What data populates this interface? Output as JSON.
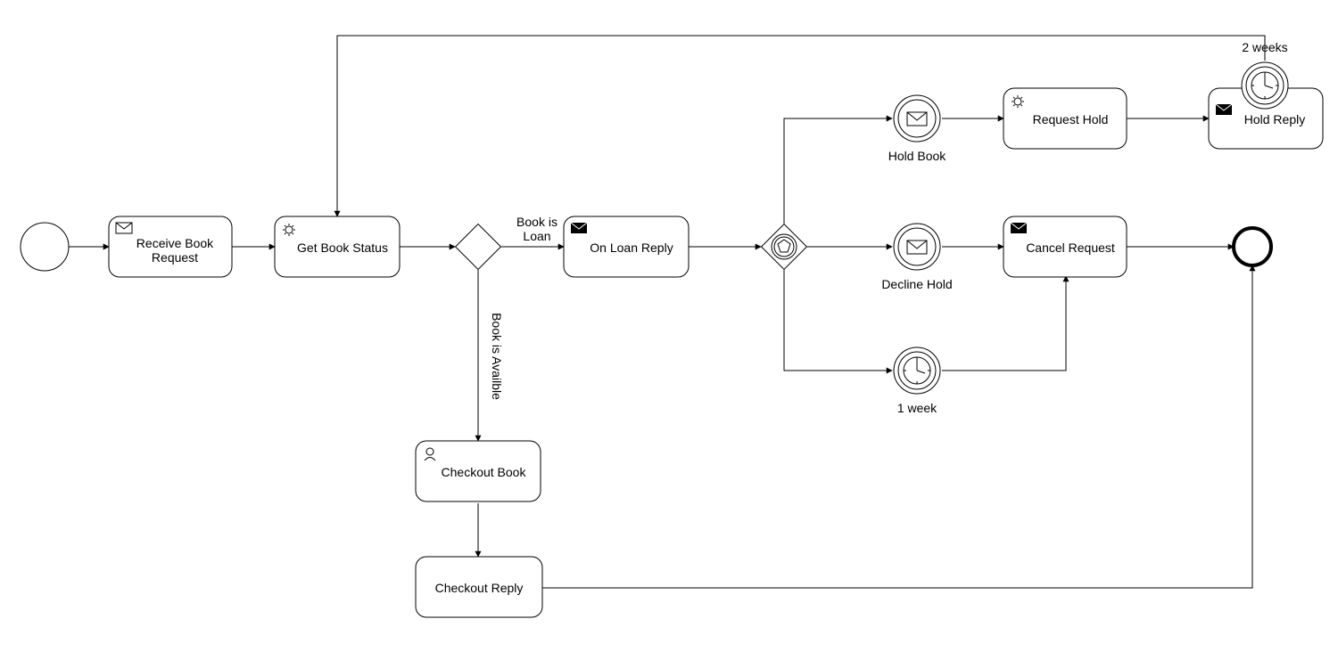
{
  "tasks": {
    "receive": "Receive Book Request",
    "getstatus": "Get Book Status",
    "onloan": "On Loan Reply",
    "requesthold": "Request Hold",
    "holdreply": "Hold Reply",
    "cancel": "Cancel Request",
    "checkoutbook": "Checkout Book",
    "checkoutreply": "Checkout Reply"
  },
  "events": {
    "holdbook": "Hold Book",
    "declinehold": "Decline Hold",
    "oneweek": "1 week",
    "twoweeks": "2 weeks"
  },
  "edges": {
    "bookloan": "Book is Loan",
    "bookavail": "Book is Availble"
  }
}
